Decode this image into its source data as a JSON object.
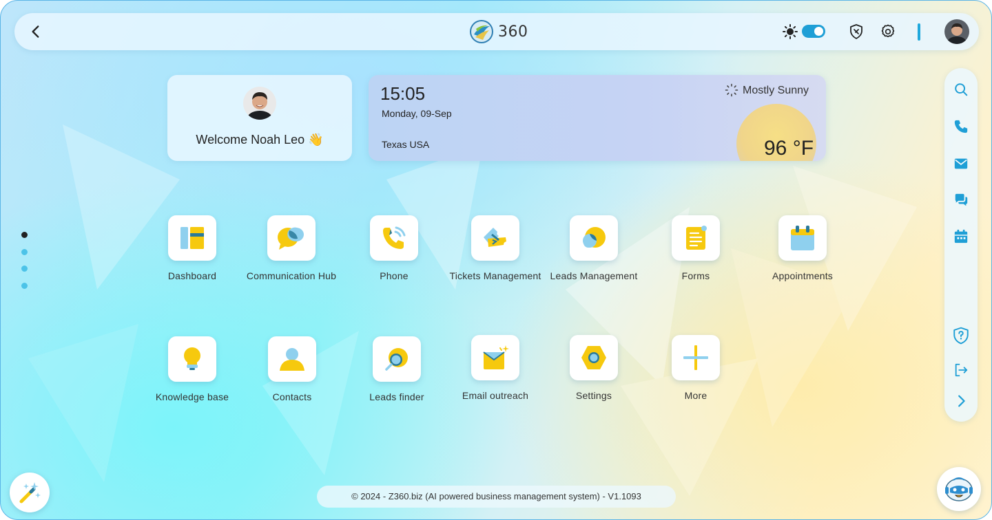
{
  "header": {
    "logo_text": "360",
    "back_icon": "chevron-left-icon",
    "theme_toggle": {
      "icon": "sun-icon",
      "enabled": true
    },
    "icons": [
      "bug-shield-icon",
      "gear-icon"
    ]
  },
  "welcome": {
    "text": "Welcome Noah Leo 👋"
  },
  "weather": {
    "time": "15:05",
    "date": "Monday, 09-Sep",
    "location": "Texas USA",
    "condition": "Mostly Sunny",
    "temperature": "96 °F"
  },
  "pagination": {
    "pages": 4,
    "active": 1
  },
  "apps": [
    {
      "label": "Dashboard",
      "icon": "dashboard-icon"
    },
    {
      "label": "Communication Hub",
      "icon": "chat-bubbles-icon"
    },
    {
      "label": "Phone",
      "icon": "phone-icon"
    },
    {
      "label": "Tickets Management",
      "icon": "tickets-icon"
    },
    {
      "label": "Leads Management",
      "icon": "leads-icon"
    },
    {
      "label": "Forms",
      "icon": "form-icon"
    },
    {
      "label": "Appointments",
      "icon": "calendar-icon"
    },
    {
      "label": "Knowledge base",
      "icon": "lightbulb-icon"
    },
    {
      "label": "Contacts",
      "icon": "contact-icon"
    },
    {
      "label": "Leads finder",
      "icon": "magnifier-icon"
    },
    {
      "label": "Email outreach",
      "icon": "email-icon"
    },
    {
      "label": "Settings",
      "icon": "hex-nut-icon"
    },
    {
      "label": "More",
      "icon": "plus-icon"
    }
  ],
  "dock": {
    "items": [
      "search-icon",
      "phone-icon",
      "mail-icon",
      "chat-icon",
      "calendar-icon",
      "help-shield-icon",
      "logout-icon",
      "chevron-right-icon"
    ]
  },
  "footer": {
    "text": "© 2024 - Z360.biz (AI powered business management system) - V1.1093"
  },
  "colors": {
    "accent": "#1f9fd6",
    "icon_yellow": "#f6c90e",
    "icon_blue": "#8fd0ee"
  }
}
